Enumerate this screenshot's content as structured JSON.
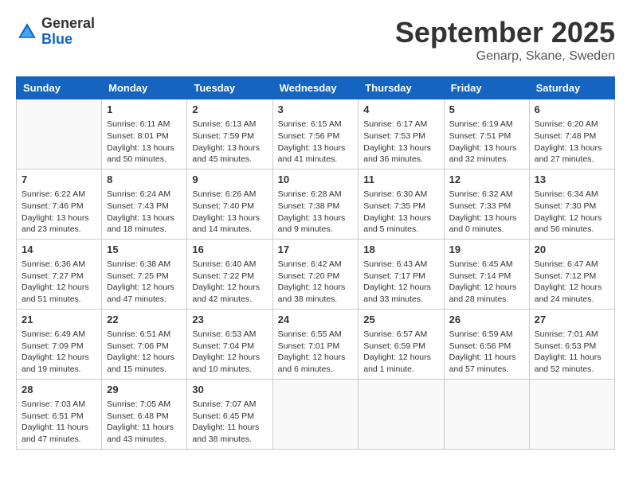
{
  "header": {
    "logo": {
      "general": "General",
      "blue": "Blue"
    },
    "title": "September 2025",
    "location": "Genarp, Skane, Sweden"
  },
  "weekdays": [
    "Sunday",
    "Monday",
    "Tuesday",
    "Wednesday",
    "Thursday",
    "Friday",
    "Saturday"
  ],
  "weeks": [
    [
      {
        "day": "",
        "empty": true
      },
      {
        "day": "1",
        "sunrise": "6:11 AM",
        "sunset": "8:01 PM",
        "daylight": "13 hours and 50 minutes."
      },
      {
        "day": "2",
        "sunrise": "6:13 AM",
        "sunset": "7:59 PM",
        "daylight": "13 hours and 45 minutes."
      },
      {
        "day": "3",
        "sunrise": "6:15 AM",
        "sunset": "7:56 PM",
        "daylight": "13 hours and 41 minutes."
      },
      {
        "day": "4",
        "sunrise": "6:17 AM",
        "sunset": "7:53 PM",
        "daylight": "13 hours and 36 minutes."
      },
      {
        "day": "5",
        "sunrise": "6:19 AM",
        "sunset": "7:51 PM",
        "daylight": "13 hours and 32 minutes."
      },
      {
        "day": "6",
        "sunrise": "6:20 AM",
        "sunset": "7:48 PM",
        "daylight": "13 hours and 27 minutes."
      }
    ],
    [
      {
        "day": "7",
        "sunrise": "6:22 AM",
        "sunset": "7:46 PM",
        "daylight": "13 hours and 23 minutes."
      },
      {
        "day": "8",
        "sunrise": "6:24 AM",
        "sunset": "7:43 PM",
        "daylight": "13 hours and 18 minutes."
      },
      {
        "day": "9",
        "sunrise": "6:26 AM",
        "sunset": "7:40 PM",
        "daylight": "13 hours and 14 minutes."
      },
      {
        "day": "10",
        "sunrise": "6:28 AM",
        "sunset": "7:38 PM",
        "daylight": "13 hours and 9 minutes."
      },
      {
        "day": "11",
        "sunrise": "6:30 AM",
        "sunset": "7:35 PM",
        "daylight": "13 hours and 5 minutes."
      },
      {
        "day": "12",
        "sunrise": "6:32 AM",
        "sunset": "7:33 PM",
        "daylight": "13 hours and 0 minutes."
      },
      {
        "day": "13",
        "sunrise": "6:34 AM",
        "sunset": "7:30 PM",
        "daylight": "12 hours and 56 minutes."
      }
    ],
    [
      {
        "day": "14",
        "sunrise": "6:36 AM",
        "sunset": "7:27 PM",
        "daylight": "12 hours and 51 minutes."
      },
      {
        "day": "15",
        "sunrise": "6:38 AM",
        "sunset": "7:25 PM",
        "daylight": "12 hours and 47 minutes."
      },
      {
        "day": "16",
        "sunrise": "6:40 AM",
        "sunset": "7:22 PM",
        "daylight": "12 hours and 42 minutes."
      },
      {
        "day": "17",
        "sunrise": "6:42 AM",
        "sunset": "7:20 PM",
        "daylight": "12 hours and 38 minutes."
      },
      {
        "day": "18",
        "sunrise": "6:43 AM",
        "sunset": "7:17 PM",
        "daylight": "12 hours and 33 minutes."
      },
      {
        "day": "19",
        "sunrise": "6:45 AM",
        "sunset": "7:14 PM",
        "daylight": "12 hours and 28 minutes."
      },
      {
        "day": "20",
        "sunrise": "6:47 AM",
        "sunset": "7:12 PM",
        "daylight": "12 hours and 24 minutes."
      }
    ],
    [
      {
        "day": "21",
        "sunrise": "6:49 AM",
        "sunset": "7:09 PM",
        "daylight": "12 hours and 19 minutes."
      },
      {
        "day": "22",
        "sunrise": "6:51 AM",
        "sunset": "7:06 PM",
        "daylight": "12 hours and 15 minutes."
      },
      {
        "day": "23",
        "sunrise": "6:53 AM",
        "sunset": "7:04 PM",
        "daylight": "12 hours and 10 minutes."
      },
      {
        "day": "24",
        "sunrise": "6:55 AM",
        "sunset": "7:01 PM",
        "daylight": "12 hours and 6 minutes."
      },
      {
        "day": "25",
        "sunrise": "6:57 AM",
        "sunset": "6:59 PM",
        "daylight": "12 hours and 1 minute."
      },
      {
        "day": "26",
        "sunrise": "6:59 AM",
        "sunset": "6:56 PM",
        "daylight": "11 hours and 57 minutes."
      },
      {
        "day": "27",
        "sunrise": "7:01 AM",
        "sunset": "6:53 PM",
        "daylight": "11 hours and 52 minutes."
      }
    ],
    [
      {
        "day": "28",
        "sunrise": "7:03 AM",
        "sunset": "6:51 PM",
        "daylight": "11 hours and 47 minutes."
      },
      {
        "day": "29",
        "sunrise": "7:05 AM",
        "sunset": "6:48 PM",
        "daylight": "11 hours and 43 minutes."
      },
      {
        "day": "30",
        "sunrise": "7:07 AM",
        "sunset": "6:45 PM",
        "daylight": "11 hours and 38 minutes."
      },
      {
        "day": "",
        "empty": true
      },
      {
        "day": "",
        "empty": true
      },
      {
        "day": "",
        "empty": true
      },
      {
        "day": "",
        "empty": true
      }
    ]
  ]
}
